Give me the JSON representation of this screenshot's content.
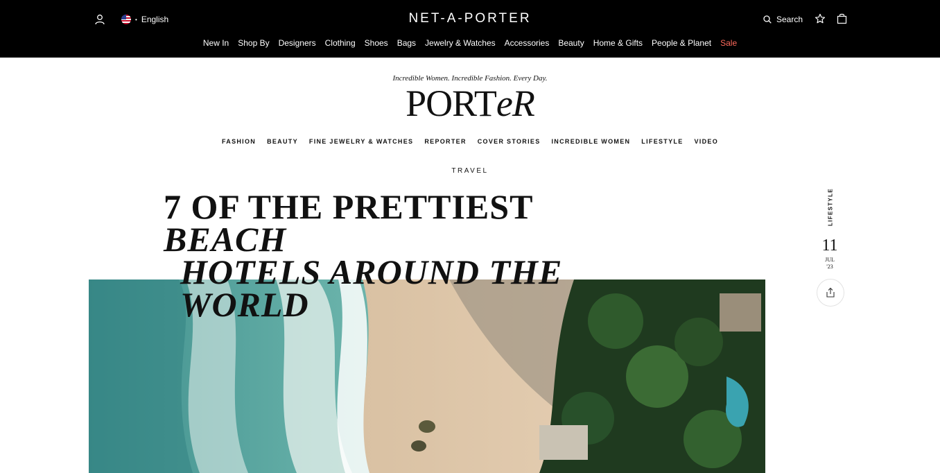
{
  "header": {
    "brand": "NET-A-PORTER",
    "language": "English",
    "search_label": "Search",
    "nav": [
      {
        "label": "New In"
      },
      {
        "label": "Shop By"
      },
      {
        "label": "Designers"
      },
      {
        "label": "Clothing"
      },
      {
        "label": "Shoes"
      },
      {
        "label": "Bags"
      },
      {
        "label": "Jewelry & Watches"
      },
      {
        "label": "Accessories"
      },
      {
        "label": "Beauty"
      },
      {
        "label": "Home & Gifts"
      },
      {
        "label": "People & Planet"
      },
      {
        "label": "Sale"
      }
    ],
    "icons": {
      "account": "user-icon",
      "flag": "us-flag-icon",
      "search": "search-icon",
      "wishlist": "star-icon",
      "bag": "bag-icon"
    },
    "sale_color": "#ff6a5c"
  },
  "porter": {
    "tagline": "Incredible Women. Incredible Fashion. Every Day.",
    "logo_part1": "PORT",
    "logo_part2": "eR",
    "nav": [
      {
        "label": "FASHION"
      },
      {
        "label": "BEAUTY"
      },
      {
        "label": "FINE JEWELRY & WATCHES"
      },
      {
        "label": "REPORTER"
      },
      {
        "label": "COVER STORIES"
      },
      {
        "label": "INCREDIBLE WOMEN"
      },
      {
        "label": "LIFESTYLE"
      },
      {
        "label": "VIDEO"
      }
    ]
  },
  "article": {
    "category": "TRAVEL",
    "title_line1_roman": "7 OF THE PRETTIEST ",
    "title_line1_italic": "BEACH",
    "title_line2": "HOTELS AROUND THE",
    "title_line3": "WORLD",
    "side_tag": "LIFESTYLE",
    "date_day": "11",
    "date_month": "JUL",
    "date_year": "'23",
    "share_icon": "share-icon"
  }
}
